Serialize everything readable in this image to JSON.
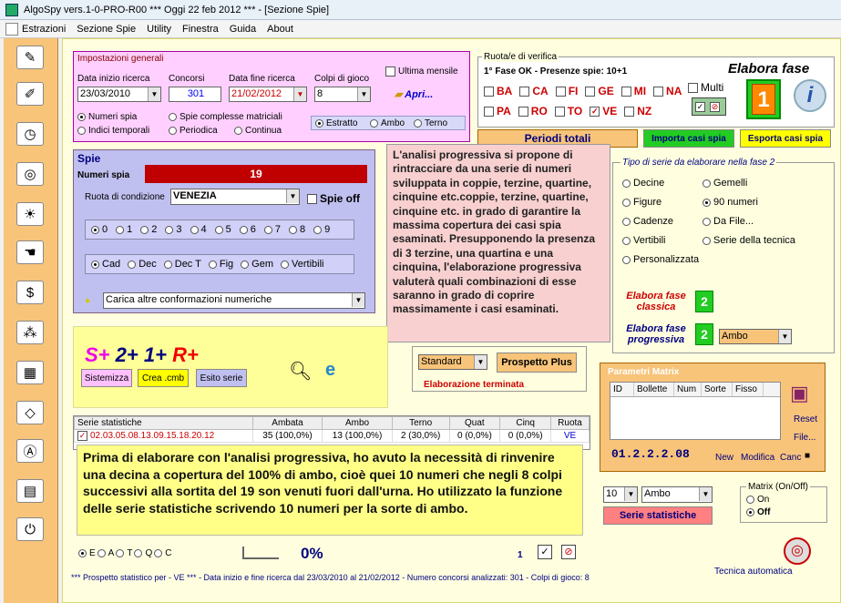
{
  "title": "AlgoSpy vers.1-0-PRO-R00  ***  Oggi 22 feb 2012  ***   - [Sezione Spie]",
  "menu": [
    "Estrazioni",
    "Sezione Spie",
    "Utility",
    "Finestra",
    "Guida",
    "About"
  ],
  "imp": {
    "title": "Impostazioni generali",
    "data_inizio_label": "Data inizio ricerca",
    "data_inizio": "23/03/2010",
    "concorsi_label": "Concorsi",
    "concorsi": "301",
    "data_fine_label": "Data fine ricerca",
    "data_fine": "21/02/2012",
    "colpi_label": "Colpi di gioco",
    "colpi": "8",
    "ultima_mensile": "Ultima mensile",
    "apri": "Apri...",
    "numeri_spia": "Numeri spia",
    "spie_complesse": "Spie complesse matriciali",
    "indici_temporali": "Indici temporali",
    "periodica": "Periodica",
    "continua": "Continua",
    "estratto": "Estratto",
    "ambo": "Ambo",
    "terno": "Terno"
  },
  "spie": {
    "title": "Spie",
    "numeri_spia_label": "Numeri spia",
    "numeri_spia_value": "19",
    "ruota_label": "Ruota di condizione",
    "ruota": "VENEZIA",
    "spie_off": "Spie off",
    "digits": [
      "0",
      "1",
      "2",
      "3",
      "4",
      "5",
      "6",
      "7",
      "8",
      "9"
    ],
    "modes": [
      "Cad",
      "Dec",
      "Dec T",
      "Fig",
      "Gem",
      "Vertibili"
    ],
    "carica": "Carica altre conformazioni numeriche"
  },
  "ruote": {
    "title": "Ruota/e di verifica",
    "fase": "1° Fase OK - Presenze spie: 10+1",
    "row1": [
      "BA",
      "CA",
      "FI",
      "GE",
      "MI",
      "NA"
    ],
    "row2": [
      "PA",
      "RO",
      "TO",
      "VE",
      "NZ"
    ],
    "checked": "VE",
    "multi": "Multi",
    "elabora": "Elabora fase",
    "fase_num": "1",
    "info": "i"
  },
  "periodi_totali": "Periodi totali",
  "importa": "Importa casi spia",
  "esporta": "Esporta casi spia",
  "tipo": {
    "title": "Tipo di serie da elaborare nella fase 2",
    "left": [
      "Decine",
      "Figure",
      "Cadenze",
      "Vertibili",
      "Personalizzata"
    ],
    "right": [
      "Gemelli",
      "90 numeri",
      "Da File...",
      "Serie della tecnica"
    ],
    "selected": "90 numeri",
    "classica": "Elabora fase classica",
    "progressiva": "Elabora fase progressiva",
    "fase2": "2",
    "ambo_sel": "Ambo"
  },
  "tooltip": "L'analisi progressiva si propone di rintracciare da una serie di numeri sviluppata in coppie, terzine, quartine, cinquine etc.coppie, terzine, quartine, cinquine etc. in grado di garantire la massima copertura dei casi spia esaminati. Presupponendo la presenza di 3 terzine, una quartina e una cinquina, l'elaborazione progressiva valuterà quali combinazioni di esse saranno in grado di coprire massimamente i casi esaminati.",
  "logo": {
    "s": "S+",
    "two": "2+",
    "one": "1+",
    "r": "R+"
  },
  "buttons": {
    "sistemizza": "Sistemizza",
    "crea": "Crea .cmb",
    "esito": "Esito serie"
  },
  "standard": "Standard",
  "prospetto": "Prospetto Plus",
  "elaborazione": "Elaborazione terminata",
  "matrix": {
    "title": "Parametri Matrix",
    "cols": [
      "ID",
      "Bollette",
      "Num",
      "Sorte",
      "Fisso"
    ],
    "reset": "Reset",
    "file": "File...",
    "code": "01.2.2.2.08",
    "new": "New",
    "modifica": "Modifica",
    "canc": "Canc"
  },
  "stat": {
    "headers": [
      "Serie statistiche",
      "Ambata",
      "Ambo",
      "Terno",
      "Quat",
      "Cinq",
      "Ruota"
    ],
    "row": [
      "02.03.05.08.13.09.15.18.20.12",
      "35 (100,0%)",
      "13 (100,0%)",
      "2 (30,0%)",
      "0 (0,0%)",
      "0 (0,0%)",
      "VE"
    ]
  },
  "note": "Prima di elaborare con l'analisi progressiva, ho avuto la necessità di rinvenire una decina a copertura del 100% di ambo, cioè quei 10 numeri che negli 8 colpi successivi alla sortita del 19 son venuti fuori dall'urna.  Ho utilizzato la funzione delle serie statistiche scrivendo 10 numeri per la sorte di ambo.",
  "serie_stat": {
    "num": "10",
    "sorte": "Ambo",
    "button": "Serie statistiche"
  },
  "matrix_onoff": {
    "title": "Matrix (On/Off)",
    "on": "On",
    "off": "Off"
  },
  "bottom": {
    "radios": [
      "E",
      "A",
      "T",
      "Q",
      "C"
    ],
    "pct": "0%",
    "one": "1",
    "tecnica": "Tecnica automatica",
    "status": "*** Prospetto statistico per  - VE ***  - Data inizio e fine ricerca dal 23/03/2010 al 21/02/2012 - Numero concorsi analizzati: 301 - Colpi di gioco: 8"
  },
  "colors": {
    "sidebar": "#f7c47a",
    "pink": "#ffd0ff",
    "lavender": "#c0c0f0",
    "red": "#c00000",
    "green": "#22cc22",
    "yellow": "#ffff00"
  }
}
